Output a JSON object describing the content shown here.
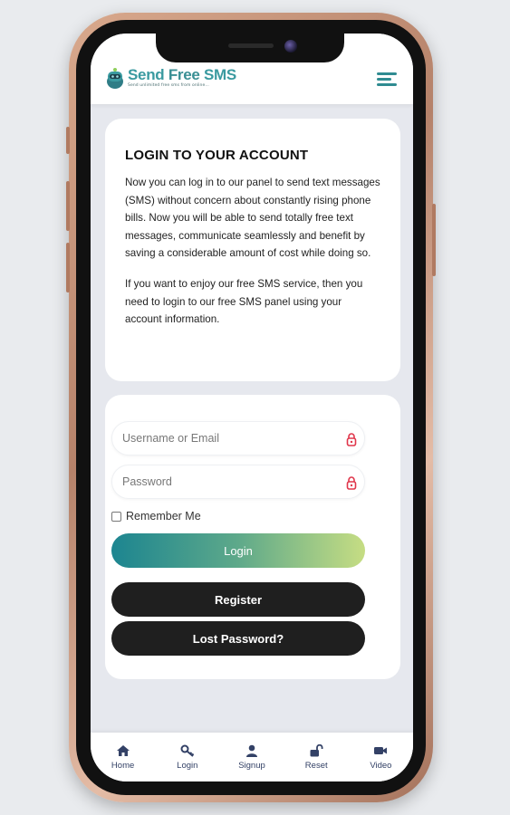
{
  "header": {
    "logo_title_send": "Send",
    "logo_title_free": "Free",
    "logo_title_sms": "SMS",
    "logo_tagline": "Send unlimited free sms from online...",
    "menu_icon": "hamburger-icon"
  },
  "info_card": {
    "title": "LOGIN TO YOUR ACCOUNT",
    "paragraph_1": "Now you can log in to our panel to send text messages (SMS) without concern about constantly rising phone bills. Now you will be able to send totally free text messages, communicate seamlessly and benefit by saving a considerable amount of cost while doing so.",
    "paragraph_2": "If you want to enjoy our free SMS service, then you need to login to our free SMS panel using your account information."
  },
  "login_form": {
    "username_placeholder": "Username or Email",
    "password_placeholder": "Password",
    "remember_label": "Remember Me",
    "login_label": "Login",
    "register_label": "Register",
    "lost_password_label": "Lost Password?"
  },
  "tabbar": {
    "items": [
      {
        "label": "Home",
        "icon": "home-icon"
      },
      {
        "label": "Login",
        "icon": "key-icon"
      },
      {
        "label": "Signup",
        "icon": "user-icon"
      },
      {
        "label": "Reset",
        "icon": "unlock-icon"
      },
      {
        "label": "Video",
        "icon": "video-icon"
      }
    ]
  },
  "colors": {
    "accent": "#2f8b91",
    "lock_icon": "#e0364b",
    "dark_button": "#1f1f1f",
    "login_gradient_start": "#1c8590",
    "login_gradient_end": "#c6dd83"
  }
}
